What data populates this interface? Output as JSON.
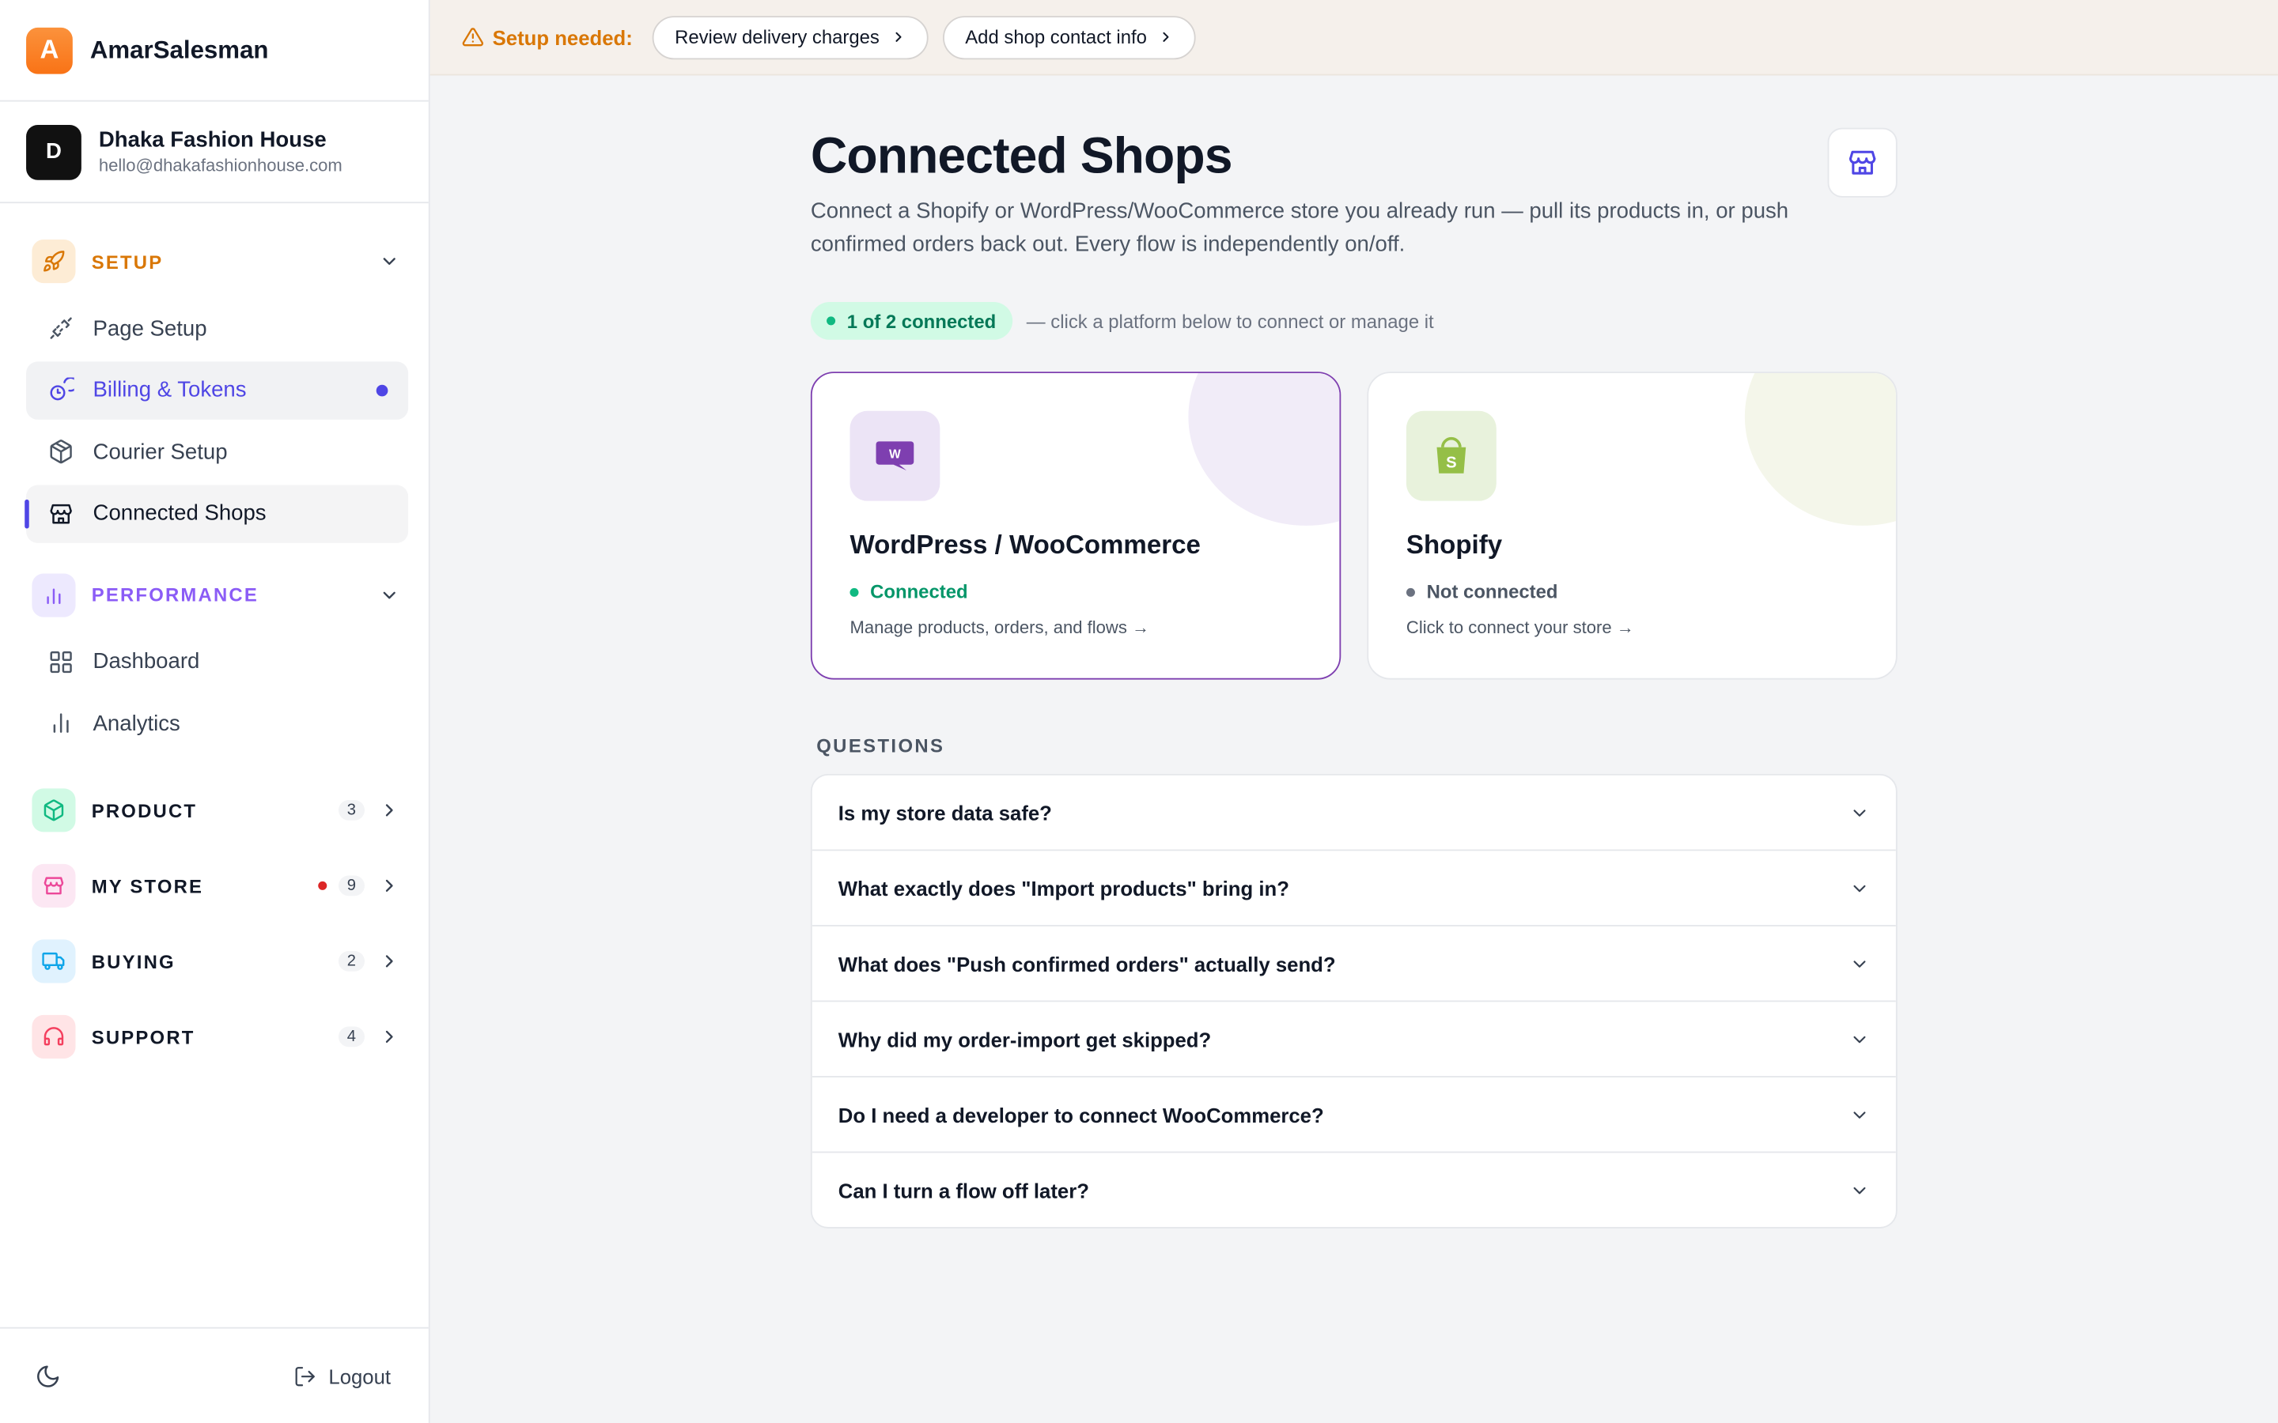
{
  "brand": {
    "logo_letter": "A",
    "name": "AmarSalesman"
  },
  "account": {
    "avatar_letter": "D",
    "name": "Dhaka Fashion House",
    "email": "hello@dhakafashionhouse.com"
  },
  "sidebar": {
    "setup": {
      "label": "SETUP",
      "items": [
        {
          "label": "Page Setup"
        },
        {
          "label": "Billing & Tokens"
        },
        {
          "label": "Courier Setup"
        },
        {
          "label": "Connected Shops"
        }
      ]
    },
    "performance": {
      "label": "PERFORMANCE",
      "items": [
        {
          "label": "Dashboard"
        },
        {
          "label": "Analytics"
        }
      ]
    },
    "product": {
      "label": "PRODUCT",
      "count": "3"
    },
    "my_store": {
      "label": "MY STORE",
      "count": "9"
    },
    "buying": {
      "label": "BUYING",
      "count": "2"
    },
    "support": {
      "label": "SUPPORT",
      "count": "4"
    },
    "logout_label": "Logout"
  },
  "setup_bar": {
    "label": "Setup needed:",
    "actions": [
      {
        "label": "Review delivery charges"
      },
      {
        "label": "Add shop contact info"
      }
    ]
  },
  "page": {
    "title": "Connected Shops",
    "description": "Connect a Shopify or WordPress/WooCommerce store you already run — pull its products in, or push confirmed orders back out. Every flow is independently on/off.",
    "status_pill": "1 of 2 connected",
    "status_hint": "— click a platform below to connect or manage it"
  },
  "cards": [
    {
      "title": "WordPress / WooCommerce",
      "status": "Connected",
      "sub": "Manage products, orders, and flows →"
    },
    {
      "title": "Shopify",
      "status": "Not connected",
      "sub": "Click to connect your store →"
    }
  ],
  "faq": {
    "heading": "QUESTIONS",
    "items": [
      {
        "q": "Is my store data safe?"
      },
      {
        "q": "What exactly does \"Import products\" bring in?"
      },
      {
        "q": "What does \"Push confirmed orders\" actually send?"
      },
      {
        "q": "Why did my order-import get skipped?"
      },
      {
        "q": "Do I need a developer to connect WooCommerce?"
      },
      {
        "q": "Can I turn a flow off later?"
      }
    ]
  },
  "colors": {
    "accent": "#4f46e5",
    "setup": "#d97706",
    "performance": "#8b5cf6",
    "connected": "#10b981",
    "woo": "#7e3fb0",
    "shopify": "#95bf47"
  }
}
